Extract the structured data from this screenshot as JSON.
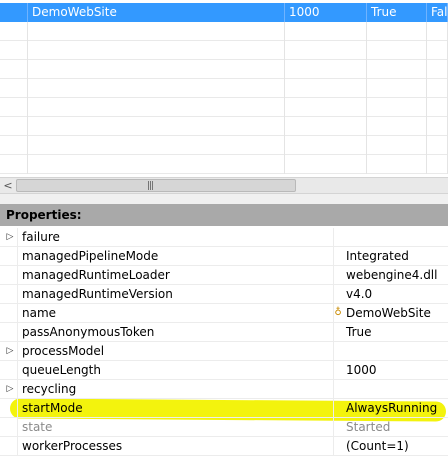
{
  "grid": {
    "selected_row": {
      "name": "DemoWebSite",
      "queue_length": "1000",
      "auto_start": "True",
      "truncated": "Fals"
    }
  },
  "properties": {
    "header": "Properties:",
    "rows": [
      {
        "name": "failure",
        "value": "",
        "expandable": true,
        "warning": false,
        "disabled": false
      },
      {
        "name": "managedPipelineMode",
        "value": "Integrated",
        "expandable": false,
        "warning": false,
        "disabled": false
      },
      {
        "name": "managedRuntimeLoader",
        "value": "webengine4.dll",
        "expandable": false,
        "warning": false,
        "disabled": false
      },
      {
        "name": "managedRuntimeVersion",
        "value": "v4.0",
        "expandable": false,
        "warning": false,
        "disabled": false
      },
      {
        "name": "name",
        "value": "DemoWebSite",
        "expandable": false,
        "warning": true,
        "disabled": false
      },
      {
        "name": "passAnonymousToken",
        "value": "True",
        "expandable": false,
        "warning": false,
        "disabled": false
      },
      {
        "name": "processModel",
        "value": "",
        "expandable": true,
        "warning": false,
        "disabled": false
      },
      {
        "name": "queueLength",
        "value": "1000",
        "expandable": false,
        "warning": false,
        "disabled": false
      },
      {
        "name": "recycling",
        "value": "",
        "expandable": true,
        "warning": false,
        "disabled": false
      },
      {
        "name": "startMode",
        "value": "AlwaysRunning",
        "expandable": false,
        "warning": false,
        "disabled": false
      },
      {
        "name": "state",
        "value": "Started",
        "expandable": false,
        "warning": false,
        "disabled": true
      },
      {
        "name": "workerProcesses",
        "value": "(Count=1)",
        "expandable": false,
        "warning": false,
        "disabled": false
      }
    ]
  },
  "icons": {
    "expand": "triangle-right-icon",
    "warning": "key-icon",
    "scroll_left": "chevron-left-icon",
    "scroll_grip": "grip-icon"
  },
  "colors": {
    "selection": "#3399ff",
    "header": "#a9a9a9",
    "highlight": "#f2f200",
    "disabled_text": "#8a8a8a"
  }
}
